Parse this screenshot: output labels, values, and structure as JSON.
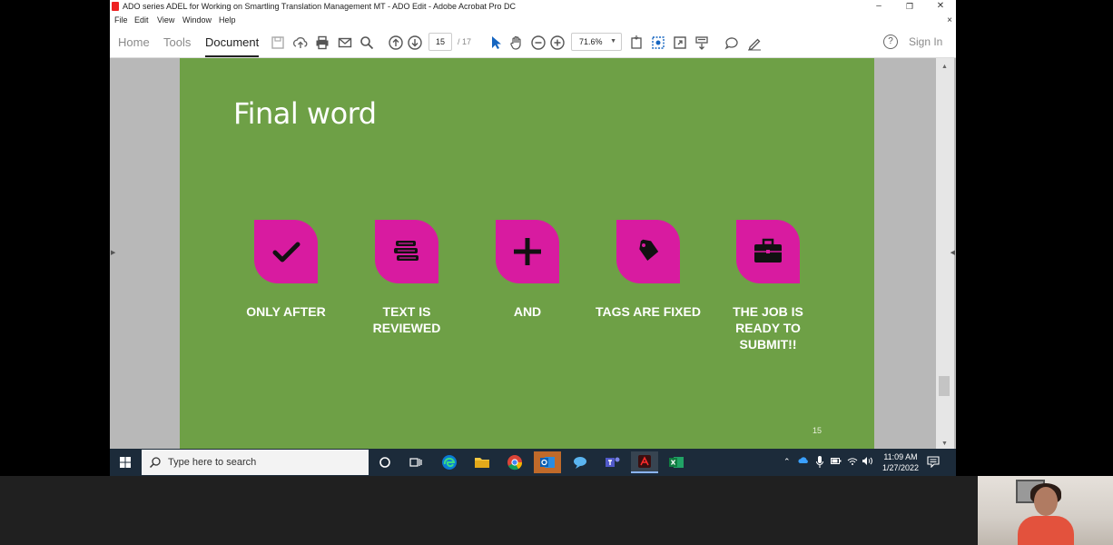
{
  "window": {
    "title": "ADO series  ADEL for  Working on Smartling  Translation Management MT - ADO Edit - Adobe Acrobat Pro DC",
    "controls": {
      "minimize": "–",
      "restore": "❐",
      "close": "✕"
    },
    "menu": [
      "File",
      "Edit",
      "View",
      "Window",
      "Help"
    ],
    "menu_close": "×"
  },
  "toolbar": {
    "tabs": [
      "Home",
      "Tools",
      "Document"
    ],
    "active_tab": "Document",
    "page_current": "15",
    "page_total": "/  17",
    "zoom": "71.6%",
    "help": "?",
    "sign_in": "Sign In"
  },
  "slide": {
    "title": "Final word",
    "page_number": "15",
    "steps": [
      {
        "icon": "checkmark-icon",
        "label": "ONLY AFTER"
      },
      {
        "icon": "books-icon",
        "label": "TEXT IS\nREVIEWED"
      },
      {
        "icon": "plus-icon",
        "label": "AND"
      },
      {
        "icon": "tag-icon",
        "label": "TAGS ARE FIXED"
      },
      {
        "icon": "briefcase-icon",
        "label": "THE JOB IS\nREADY TO\nSUBMIT!!"
      }
    ],
    "colors": {
      "background": "#6ea046",
      "badge": "#d81ba0",
      "text": "#ffffff"
    }
  },
  "taskbar": {
    "search_placeholder": "Type here to search",
    "time": "11:09 AM",
    "date": "1/27/2022",
    "apps": [
      "cortana-icon",
      "task-view-icon",
      "edge-icon",
      "file-explorer-icon",
      "chrome-icon",
      "outlook-icon",
      "chat-icon",
      "teams-icon",
      "acrobat-icon",
      "excel-icon"
    ]
  }
}
